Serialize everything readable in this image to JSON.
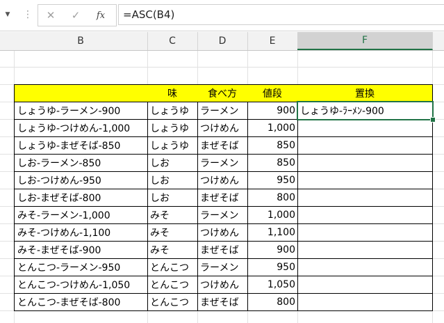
{
  "formula_bar": {
    "close_glyph": "✕",
    "enter_glyph": "✓",
    "fx_label": "fx",
    "formula": "=ASC(B4)"
  },
  "columns": [
    {
      "letter": "B",
      "selected": false
    },
    {
      "letter": "C",
      "selected": false
    },
    {
      "letter": "D",
      "selected": false
    },
    {
      "letter": "E",
      "selected": false
    },
    {
      "letter": "F",
      "selected": true
    }
  ],
  "table": {
    "headers": [
      "",
      "味",
      "食べ方",
      "値段",
      "置換"
    ],
    "rows": [
      [
        "しょうゆ-ラーメン-900",
        "しょうゆ",
        "ラーメン",
        "900",
        "しょうゆ-ﾗｰﾒﾝ-900"
      ],
      [
        "しょうゆ-つけめん-1,000",
        "しょうゆ",
        "つけめん",
        "1,000",
        ""
      ],
      [
        "しょうゆ-まぜそば-850",
        "しょうゆ",
        "まぜそば",
        "850",
        ""
      ],
      [
        "しお-ラーメン-850",
        "しお",
        "ラーメン",
        "850",
        ""
      ],
      [
        "しお-つけめん-950",
        "しお",
        "つけめん",
        "950",
        ""
      ],
      [
        "しお-まぜそば-800",
        "しお",
        "まぜそば",
        "800",
        ""
      ],
      [
        "みそ-ラーメン-1,000",
        "みそ",
        "ラーメン",
        "1,000",
        ""
      ],
      [
        "みそ-つけめん-1,100",
        "みそ",
        "つけめん",
        "1,100",
        ""
      ],
      [
        "みそ-まぜそば-900",
        "みそ",
        "まぜそば",
        "900",
        ""
      ],
      [
        "とんこつ-ラーメン-950",
        "とんこつ",
        "ラーメン",
        "950",
        ""
      ],
      [
        "とんこつ-つけめん-1,050",
        "とんこつ",
        "つけめん",
        "1,050",
        ""
      ],
      [
        "とんこつ-まぜそば-800",
        "とんこつ",
        "まぜそば",
        "800",
        ""
      ]
    ]
  },
  "colors": {
    "header_fill": "#ffff00",
    "selection": "#217346"
  }
}
